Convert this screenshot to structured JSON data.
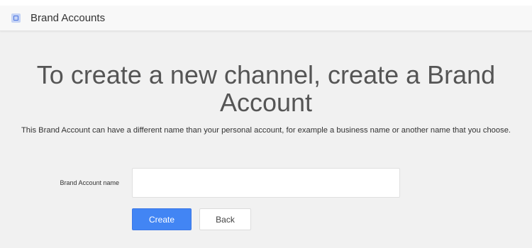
{
  "header": {
    "icon": "brand-accounts-icon",
    "title": "Brand Accounts"
  },
  "main": {
    "headline": "To create a new channel, create a Brand Account",
    "description": "This Brand Account can have a different name than your personal account, for example a business name or another name that you choose.",
    "form": {
      "name_label": "Brand Account name",
      "name_value": "",
      "create_label": "Create",
      "back_label": "Back"
    }
  },
  "colors": {
    "primary_button": "#4285f4",
    "background": "#f1f1f1",
    "header_background": "#f8f8f8"
  }
}
